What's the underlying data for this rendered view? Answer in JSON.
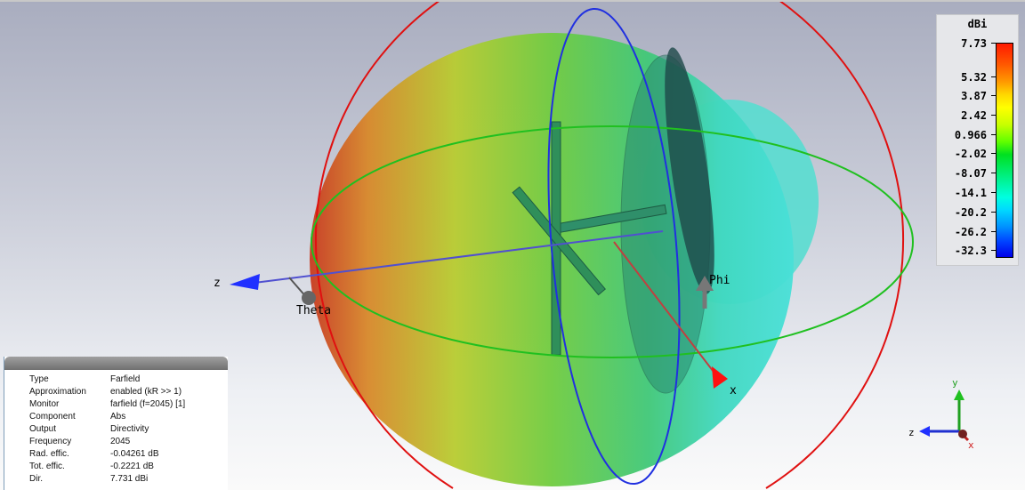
{
  "colorbar": {
    "unit": "dBi",
    "ticks": [
      "7.73",
      "5.32",
      "3.87",
      "2.42",
      "0.966",
      "-2.02",
      "-8.07",
      "-14.1",
      "-20.2",
      "-26.2",
      "-32.3"
    ],
    "max": 7.73,
    "min": -32.3
  },
  "axes": {
    "z": "z",
    "x": "x",
    "theta": "Theta",
    "phi": "Phi"
  },
  "triad": {
    "y": "y",
    "z": "z",
    "x": "x"
  },
  "info": [
    {
      "key": "Type",
      "value": "Farfield"
    },
    {
      "key": "Approximation",
      "value": "enabled (kR >> 1)"
    },
    {
      "key": "Monitor",
      "value": "farfield (f=2045) [1]"
    },
    {
      "key": "Component",
      "value": "Abs"
    },
    {
      "key": "Output",
      "value": "Directivity"
    },
    {
      "key": "Frequency",
      "value": "2045"
    },
    {
      "key": "Rad. effic.",
      "value": "-0.04261 dB"
    },
    {
      "key": "Tot. effic.",
      "value": "-0.2221 dB"
    },
    {
      "key": "Dir.",
      "value": "7.731 dBi"
    }
  ]
}
